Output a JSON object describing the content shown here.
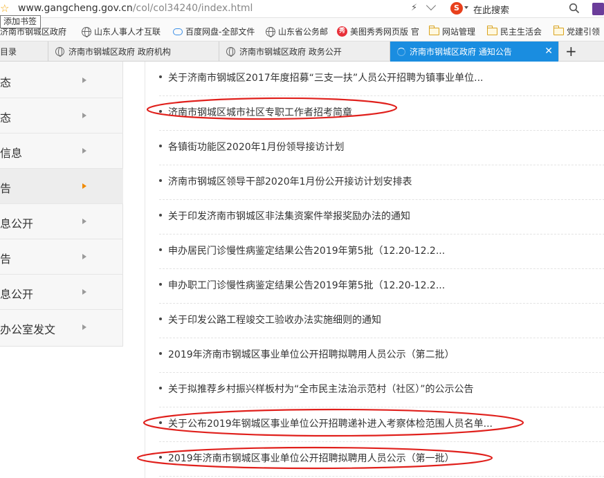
{
  "browser": {
    "url_host": "www.gangcheng.gov.cn",
    "url_path": "/col/col34240/index.html",
    "search_placeholder": "在此搜索",
    "tooltip": "添加书签"
  },
  "bookmarks": [
    {
      "label": "济南市钢城区政府",
      "icon": "globe-icon"
    },
    {
      "label": "山东人事人才互联",
      "icon": "globe-icon"
    },
    {
      "label": "百度网盘-全部文件",
      "icon": "cloud-icon"
    },
    {
      "label": "山东省公务邮",
      "icon": "globe-icon"
    },
    {
      "label": "美图秀秀网页版 官",
      "icon": "meitu-icon"
    },
    {
      "label": "网站管理",
      "icon": "folder-icon"
    },
    {
      "label": "民主生活会",
      "icon": "folder-icon"
    },
    {
      "label": "党建引领",
      "icon": "folder-icon"
    }
  ],
  "tabs": [
    {
      "label": "目录",
      "active": false
    },
    {
      "label": "济南市钢城区政府 政府机构",
      "active": false
    },
    {
      "label": "济南市钢城区政府 政务公开",
      "active": false
    },
    {
      "label": "济南市钢城区政府 通知公告",
      "active": true
    }
  ],
  "sidebar": {
    "items": [
      {
        "label": "态",
        "active": false
      },
      {
        "label": "态",
        "active": false
      },
      {
        "label": "信息",
        "active": false
      },
      {
        "label": "告",
        "active": true
      },
      {
        "label": "息公开",
        "active": false
      },
      {
        "label": "告",
        "active": false
      },
      {
        "label": "息公开",
        "active": false
      },
      {
        "label": "办公室发文",
        "active": false
      }
    ]
  },
  "notices": [
    "关于济南市钢城区2017年度招募“三支一扶”人员公开招聘为镇事业单位...",
    "济南市钢城区城市社区专职工作者招考简章",
    "各镇街功能区2020年1月份领导接访计划",
    "济南市钢城区领导干部2020年1月份公开接访计划安排表",
    "关于印发济南市钢城区非法集资案件举报奖励办法的通知",
    "申办居民门诊慢性病鉴定结果公告2019年第5批（12.20-12.2...",
    "申办职工门诊慢性病鉴定结果公告2019年第5批（12.20-12.2...",
    "关于印发公路工程竣交工验收办法实施细则的通知",
    "2019年济南市钢城区事业单位公开招聘拟聘用人员公示（第二批）",
    "关于拟推荐乡村振兴样板村为“全市民主法治示范村（社区）”的公示公告",
    "关于公布2019年钢城区事业单位公开招聘递补进入考察体检范围人员名单...",
    "2019年济南市钢城区事业单位公开招聘拟聘用人员公示（第一批）"
  ],
  "colors": {
    "active_tab": "#1a8de0",
    "annotation": "#e0201c",
    "active_arrow": "#f08a00"
  }
}
